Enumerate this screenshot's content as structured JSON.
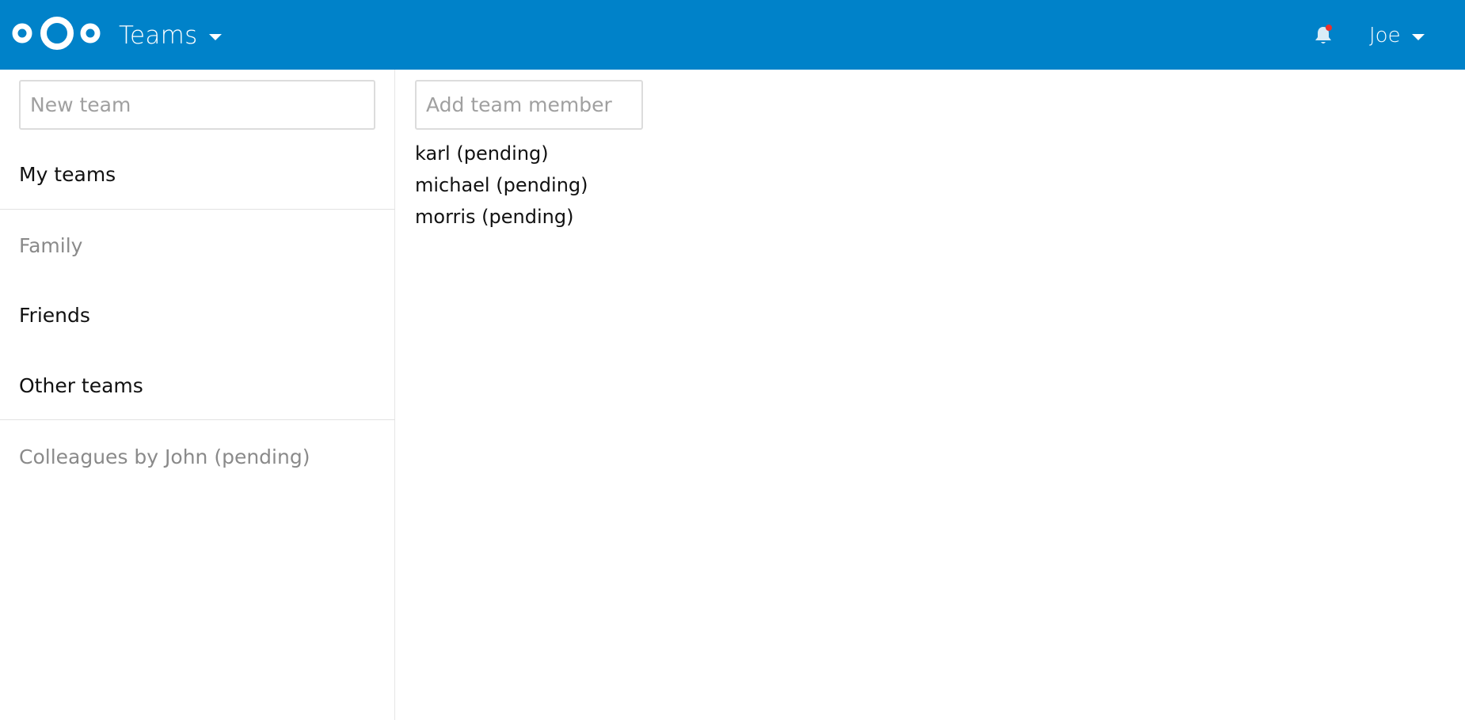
{
  "header": {
    "app_name": "Teams",
    "user_name": "Joe",
    "brand_color": "#0082c9",
    "notification_dot_color": "#e9322d",
    "icons": {
      "logo": "nextcloud-logo-icon",
      "app_menu": "chevron-down-icon",
      "notifications": "bell-icon",
      "user_menu": "chevron-down-icon"
    }
  },
  "sidebar": {
    "new_team_placeholder": "New team",
    "my_teams_label": "My teams",
    "my_teams": [
      {
        "label": "Family",
        "active": true
      },
      {
        "label": "Friends",
        "active": false
      }
    ],
    "other_teams_label": "Other teams",
    "other_teams": [
      {
        "label": "Colleagues by John (pending)"
      }
    ]
  },
  "main": {
    "add_member_placeholder": "Add team member",
    "members": [
      "karl (pending)",
      "michael (pending)",
      "morris (pending)"
    ]
  }
}
